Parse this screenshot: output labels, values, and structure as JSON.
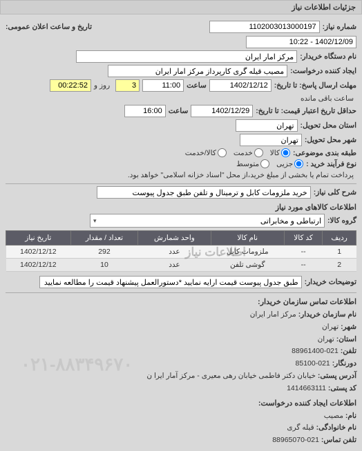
{
  "header": {
    "title": "جزئیات اطلاعات نیاز"
  },
  "labels": {
    "req_no": "شماره نیاز:",
    "pub_datetime": "تاریخ و ساعت اعلان عمومی:",
    "buyer": "نام دستگاه خریدار:",
    "creator": "ایجاد کننده درخواست:",
    "deadline": "مهلت ارسال پاسخ: تا تاریخ:",
    "validity": "حداقل تاریخ اعتبار قیمت: تا تاریخ:",
    "time": "ساعت",
    "remaining_days": "روز و",
    "remaining_time": "ساعت باقی مانده",
    "province": "استان محل تحویل:",
    "city": "شهر محل تحویل:",
    "subject_cat": "طبقه بندی موضوعی:",
    "buy_process": "نوع فرآیند خرید :",
    "buy_note": "پرداخت تمام یا بخشی از مبلغ خرید،از محل \"اسناد خزانه اسلامی\" خواهد بود.",
    "general_desc": "شرح کلی نیاز:",
    "goods_section": "اطلاعات کالاهای مورد نیاز",
    "goods_group": "گروه کالا:",
    "buyer_notes": "توضیحات خریدار:",
    "contact_section": "اطلاعات تماس سازمان خریدار:",
    "creator_contact_section": "اطلاعات ایجاد کننده درخواست:",
    "org_name": "نام سازمان خریدار:",
    "city_lbl": "شهر:",
    "province_lbl": "استان:",
    "phone_lbl": "تلفن:",
    "fax_lbl": "دورنگار:",
    "postal_addr": "آدرس پستی:",
    "postal_code": "کد پستی:",
    "name_lbl": "نام:",
    "surname_lbl": "نام خانوادگی:",
    "contact_phone": "تلفن تماس:"
  },
  "values": {
    "req_no": "1102003013000197",
    "pub_datetime": "1402/12/09 - 10:22",
    "buyer": "مرکز امار ایران",
    "creator": "مصیب قیله گری کارپرداز مرکز امار ایران",
    "deadline_date": "1402/12/12",
    "deadline_time": "11:00",
    "remaining_days": "3",
    "remaining_time": "00:22:52",
    "validity_date": "1402/12/29",
    "validity_time": "16:00",
    "province": "تهران",
    "city": "تهران",
    "general_desc": "خرید ملزومات کابل و ترمینال و تلفن طبق جدول پیوست",
    "goods_group": "ارتباطی و مخابراتی",
    "buyer_notes": "طبق جدول پیوست قیمت ارایه نمایید *دستورالعمل پیشنهاد قیمت را مطالعه نمایید"
  },
  "radios": {
    "subject": [
      {
        "label": "کالا",
        "checked": true
      },
      {
        "label": "خدمت",
        "checked": false
      },
      {
        "label": "کالا/خدمت",
        "checked": false
      }
    ],
    "process": [
      {
        "label": "جزیی",
        "checked": true
      },
      {
        "label": "متوسط",
        "checked": false
      }
    ]
  },
  "table": {
    "headers": [
      "ردیف",
      "کد کالا",
      "نام کالا",
      "واحد شمارش",
      "تعداد / مقدار",
      "تاریخ نیاز"
    ],
    "rows": [
      {
        "idx": "1",
        "code": "--",
        "name": "ملزومات کابل",
        "unit": "عدد",
        "qty": "292",
        "date": "1402/12/12"
      },
      {
        "idx": "2",
        "code": "--",
        "name": "گوشی تلفن",
        "unit": "عدد",
        "qty": "10",
        "date": "1402/12/12"
      }
    ]
  },
  "table_overlay": "اطلاعات نیاز",
  "contact": {
    "org_name": "مرکز امار ایران",
    "city": "تهران",
    "province": "تهران",
    "phone": "021-88961400",
    "fax": "021-85100",
    "postal_addr": "خیابان دکتر فاطمی خیابان رهی معیری - مرکز آمار ایرا ن",
    "postal_code": "1414663111"
  },
  "creator_contact": {
    "name": "مصیب",
    "surname": "قیله گری",
    "phone": "021-88965070"
  },
  "watermark": "۰۲۱-۸۸۳۴۹۶۷۰"
}
